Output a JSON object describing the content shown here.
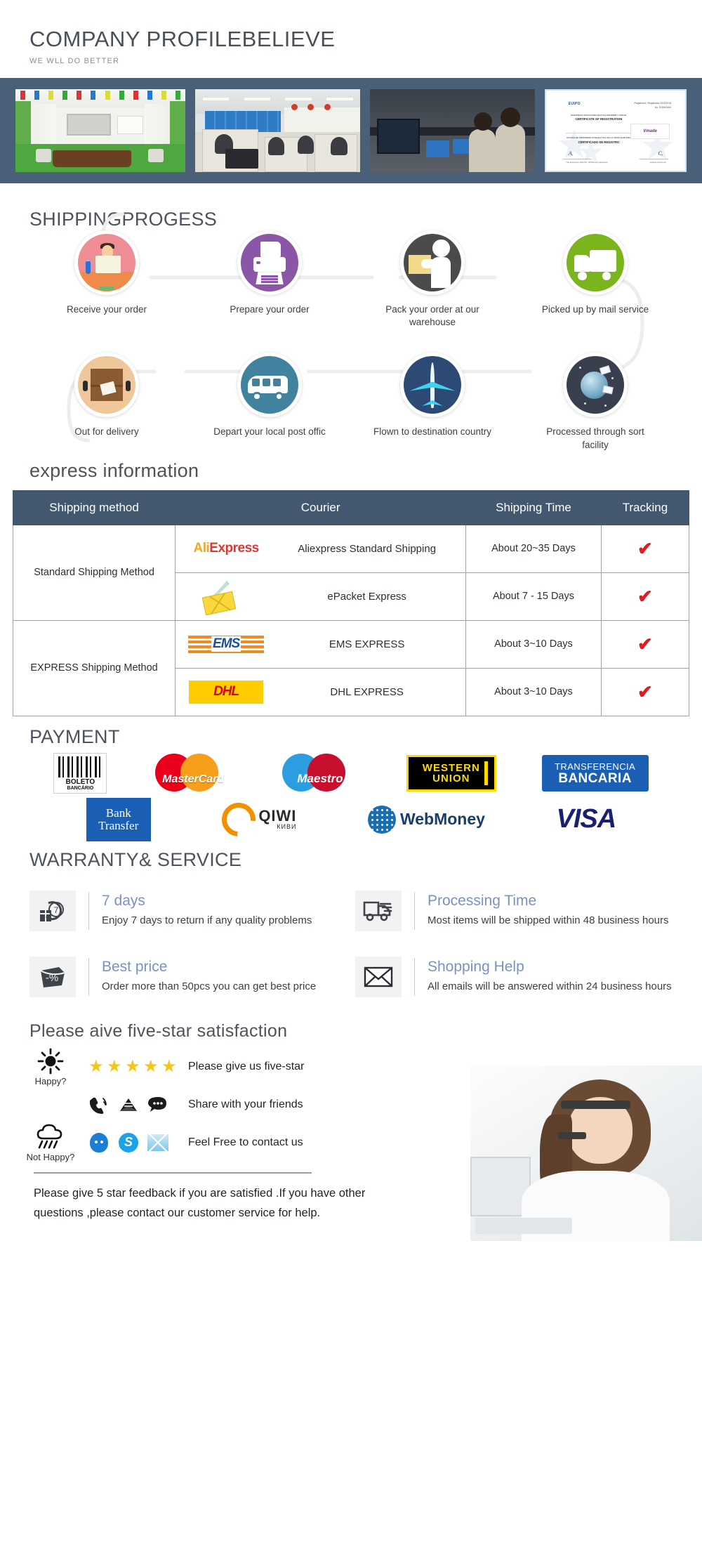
{
  "header": {
    "title": "COMPANY PROFILEBELIEVE",
    "subtitle": "WE WLL DO BETTER"
  },
  "banner": {
    "photos": [
      {
        "name": "meeting-room-photo",
        "alt": "Company meeting room"
      },
      {
        "name": "office-photo",
        "alt": "Office staff working"
      },
      {
        "name": "factory-photo",
        "alt": "Factory production line"
      },
      {
        "name": "certificate-photo",
        "alt": "Certificate of registration"
      }
    ],
    "certificate": {
      "brand": "EUIPO",
      "right_line1": "Registered / Registrada 2019/2018",
      "right_line2": "No. 018262464",
      "title_en": "CERTIFICATE OF REGISTRATION",
      "subtitle_en": "EUROPEAN UNION INTELLECTUAL PROPERTY OFFICE",
      "title_es": "CERTIFICADO DE REGISTRO",
      "subtitle_es": "OFICINA DE PROPIEDAD INTELECTUAL DE LA UNION EUROPEA",
      "mark": "Vmade",
      "sign_role": "The Executive Director / El Director Ejecutivo",
      "sign_name": "Andrea Campora"
    }
  },
  "shipping": {
    "title": "SHIPPINGPROGESS",
    "steps_row1": [
      {
        "label": "Receive your order",
        "icon": "customer-desk-icon",
        "color": "#ef8d95"
      },
      {
        "label": "Prepare your order",
        "icon": "printer-icon",
        "color": "#8b55a8"
      },
      {
        "label": "Pack your order at\nour warehouse",
        "icon": "packing-worker-icon",
        "color": "#4b4b4b"
      },
      {
        "label": "Picked up by mail service",
        "icon": "delivery-truck-icon",
        "color": "#7ab51d"
      }
    ],
    "steps_row2": [
      {
        "label": "Out for delivery",
        "icon": "parcel-crate-icon",
        "color": "#f0c79a"
      },
      {
        "label": "Depart your local\npost offic",
        "icon": "postal-van-icon",
        "color": "#41839f"
      },
      {
        "label": "Flown to\ndestination country",
        "icon": "airplane-icon",
        "color": "#2c4a74"
      },
      {
        "label": "Processed through\nsort facility",
        "icon": "globe-sorting-icon",
        "color": "#3a3f4d"
      }
    ]
  },
  "express": {
    "title": "express information",
    "columns": [
      "Shipping method",
      "Courier",
      "Shipping Time",
      "Tracking"
    ],
    "groups": [
      {
        "method": "Standard Shipping Method",
        "rows": [
          {
            "logo": "aliexpress-logo",
            "courier": "Aliexpress Standard Shipping",
            "time": "About 20~35 Days",
            "tracking": "✔"
          },
          {
            "logo": "epacket-logo",
            "courier": "ePacket Express",
            "time": "About 7 - 15 Days",
            "tracking": "✔"
          }
        ]
      },
      {
        "method": "EXPRESS Shipping Method",
        "rows": [
          {
            "logo": "ems-logo",
            "courier": "EMS EXPRESS",
            "time": "About 3~10 Days",
            "tracking": "✔"
          },
          {
            "logo": "dhl-logo",
            "courier": "DHL EXPRESS",
            "time": "About 3~10 Days",
            "tracking": "✔"
          }
        ]
      }
    ],
    "logo_text": {
      "aliexpress_a": "Ali",
      "aliexpress_e": "Express",
      "ems": "EMS",
      "dhl": "DHL"
    },
    "check_color": "#e01b22"
  },
  "payment": {
    "title": "PAYMENT",
    "row1": [
      {
        "name": "boleto-bancario-logo",
        "line1": "BOLETO",
        "line2": "BANCÁRIO"
      },
      {
        "name": "mastercard-logo",
        "label": "MasterCard"
      },
      {
        "name": "maestro-logo",
        "label": "Maestro"
      },
      {
        "name": "western-union-logo",
        "line1": "WESTERN",
        "line2": "UNION"
      },
      {
        "name": "transferencia-bancaria-logo",
        "line1": "TRANSFERENCIA",
        "line2": "BANCARIA"
      }
    ],
    "row2": [
      {
        "name": "bank-transfer-logo",
        "line1": "Bank",
        "line2": "Transfer"
      },
      {
        "name": "qiwi-logo",
        "label": "QIWI",
        "sub": "КИВИ"
      },
      {
        "name": "webmoney-logo",
        "label": "WebMoney"
      },
      {
        "name": "visa-logo",
        "label": "VISA"
      }
    ]
  },
  "warranty": {
    "title": "WARRANTY& SERVICE",
    "cards": [
      {
        "icon": "clock-return-icon",
        "title": "7 days",
        "desc": "Enjoy 7 days to return\nif any quality problems"
      },
      {
        "icon": "shipping-truck-icon",
        "title": "Processing Time",
        "desc": "Most items will be shipped\nwithin 48 business hours"
      },
      {
        "icon": "discount-icon",
        "title": "Best price",
        "desc": "Order more than 50pcs\nyou can get best price"
      },
      {
        "icon": "envelope-icon",
        "title": "Shopping Help",
        "desc": "All emails will be answered\nwithin 24 business hours"
      }
    ],
    "accent_color": "#7b91c4"
  },
  "feedback": {
    "title": "Please aive five-star satisfaction",
    "rows": [
      {
        "mood": "Happy?",
        "mood_icon": "sun-icon",
        "icons": [
          "star-icon",
          "star-icon",
          "star-icon",
          "star-icon",
          "star-icon"
        ],
        "message": "Please give us five-star"
      },
      {
        "mood": "",
        "mood_icon": "",
        "icons": [
          "phone-icon",
          "mail-icon",
          "chat-icon"
        ],
        "message": "Share with your friends"
      },
      {
        "mood": "Not Happy?",
        "mood_icon": "rain-cloud-icon",
        "icons": [
          "qq-icon",
          "skype-icon",
          "email-icon"
        ],
        "message": "Feel Free to contact us"
      }
    ],
    "footer": "Please give 5 star feedback if you are satisfied .If you have other questions ,please contact our customer service for help.",
    "star_color": "#f5c518"
  }
}
